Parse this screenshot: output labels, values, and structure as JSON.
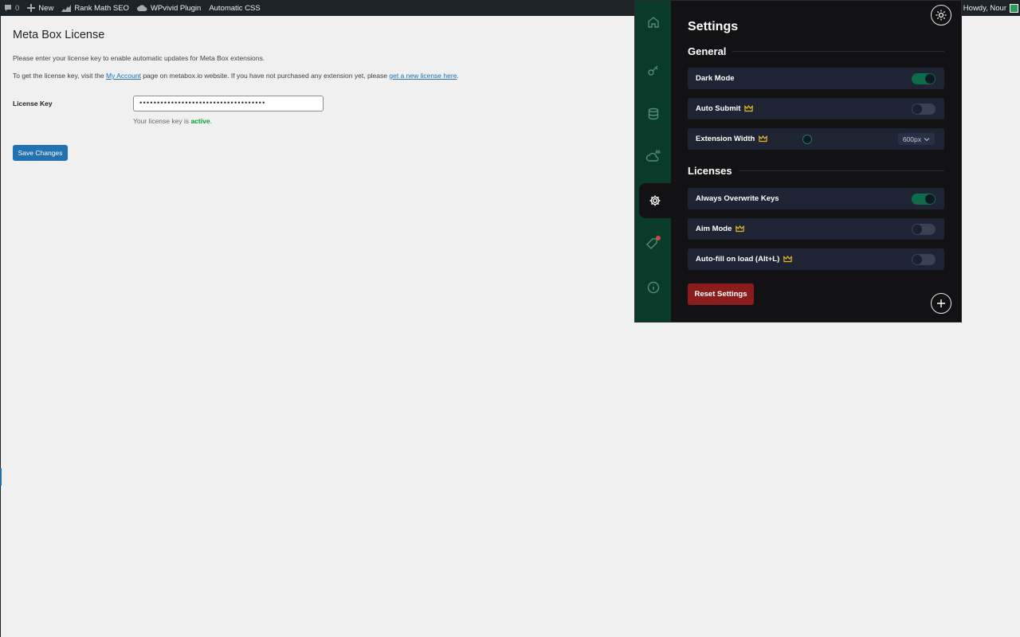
{
  "adminbar": {
    "comments_count": "0",
    "new_label": "New",
    "rank_math_label": "Rank Math SEO",
    "wpvivid_label": "WPvivid Plugin",
    "automatic_css_label": "Automatic CSS",
    "howdy_label": "Howdy, Nour"
  },
  "page": {
    "title": "Meta Box License",
    "desc1": "Please enter your license key to enable automatic updates for Meta Box extensions.",
    "desc2_before": "To get the license key, visit the ",
    "desc2_link1": "My Account",
    "desc2_middle": " page on metabox.io website. If you have not purchased any extension yet, please ",
    "desc2_link2": "get a new license here",
    "desc2_after": ".",
    "license_label": "License Key",
    "license_value": "••••••••••••••••••••••••••••••••••••",
    "status_before": "Your license key is ",
    "status_active": "active",
    "status_after": ".",
    "save_label": "Save Changes"
  },
  "panel": {
    "title": "Settings",
    "general_title": "General",
    "licenses_title": "Licenses",
    "dark_mode_label": "Dark Mode",
    "dark_mode_on": true,
    "auto_submit_label": "Auto Submit",
    "auto_submit_on": false,
    "extension_width_label": "Extension Width",
    "extension_width_value": "600px",
    "always_overwrite_label": "Always Overwrite Keys",
    "always_overwrite_on": true,
    "aim_mode_label": "Aim Mode",
    "aim_mode_on": false,
    "autofill_label": "Auto-fill on load (Alt+L)",
    "autofill_on": false,
    "reset_label": "Reset Settings",
    "colors": {
      "accent": "#0f6b4a",
      "sidebar": "#0a3b2a",
      "row": "#1e2433",
      "crown": "#e8b923",
      "reset": "#8b1c1c"
    }
  }
}
